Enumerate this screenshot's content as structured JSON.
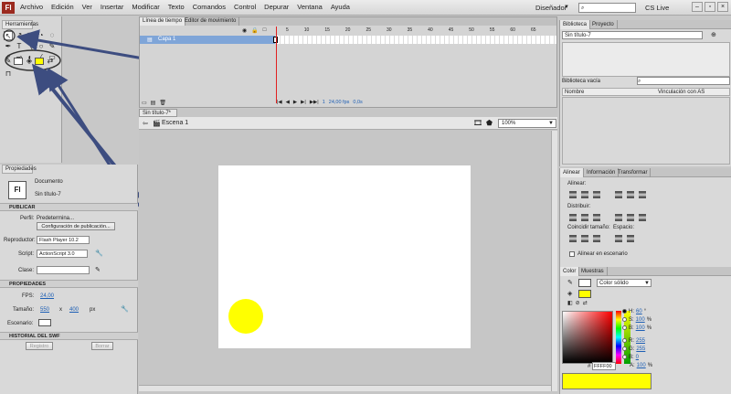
{
  "app": {
    "logo": "Fl"
  },
  "menu": [
    "Archivo",
    "Edición",
    "Ver",
    "Insertar",
    "Modificar",
    "Texto",
    "Comandos",
    "Control",
    "Depurar",
    "Ventana",
    "Ayuda"
  ],
  "workspace": "Diseñador",
  "cs_live": "CS Live",
  "tools_panel": {
    "tab": "Herramientas"
  },
  "timeline": {
    "tabs": [
      "Línea de tiempo",
      "Editor de movimiento"
    ],
    "layer": "Capa 1",
    "ruler": [
      "5",
      "10",
      "15",
      "20",
      "25",
      "30",
      "35",
      "40",
      "45",
      "50",
      "55",
      "60",
      "65"
    ],
    "fps": "24,00 fps",
    "time": "0,0s",
    "frame": "1"
  },
  "document": {
    "tab": "Sin título-7*",
    "scene": "Escena 1",
    "zoom": "100%"
  },
  "properties": {
    "tab": "Propiedades",
    "doc_icon": "Fl",
    "doc_type": "Documento",
    "doc_name": "Sin título-7",
    "publish_header": "PUBLICAR",
    "profile_label": "Perfil:",
    "profile_value": "Predetermina...",
    "publish_settings": "Configuración de publicación...",
    "player_label": "Reproductor:",
    "player_value": "Flash Player 10.2",
    "script_label": "Script:",
    "script_value": "ActionScript 3.0",
    "class_label": "Clase:",
    "props_header": "PROPIEDADES",
    "fps_label": "FPS:",
    "fps_value": "24,00",
    "size_label": "Tamaño:",
    "width": "550",
    "x": "x",
    "height": "400",
    "px": "px",
    "stage_label": "Escenario:",
    "swf_header": "HISTORIAL DEL SWF",
    "log_button": "Registro",
    "clear_button": "Borrar"
  },
  "library": {
    "tabs": [
      "Biblioteca",
      "Proyecto"
    ],
    "document": "Sin título-7",
    "empty": "Biblioteca vacía",
    "col_name": "Nombre",
    "col_linkage": "Vinculación con AS"
  },
  "align": {
    "tabs": [
      "Alinear",
      "Información",
      "Transformar"
    ],
    "align_label": "Alinear:",
    "distribute_label": "Distribuir:",
    "match_label": "Coincidir tamaño:",
    "space_label": "Espacio:",
    "to_stage": "Alinear en escenario"
  },
  "color": {
    "tabs": [
      "Color",
      "Muestras"
    ],
    "type": "Color sólido",
    "H": {
      "label": "H:",
      "value": "60",
      "unit": "°"
    },
    "S": {
      "label": "S:",
      "value": "100",
      "unit": "%"
    },
    "B": {
      "label": "B:",
      "value": "100",
      "unit": "%"
    },
    "R": {
      "label": "R:",
      "value": "255"
    },
    "G": {
      "label": "G:",
      "value": "255"
    },
    "Bb": {
      "label": "B:",
      "value": "0"
    },
    "A": {
      "label": "A:",
      "value": "100",
      "unit": "%"
    },
    "hex_label": "#",
    "hex": "FFFF00",
    "fill_color": "#FFFF00"
  }
}
